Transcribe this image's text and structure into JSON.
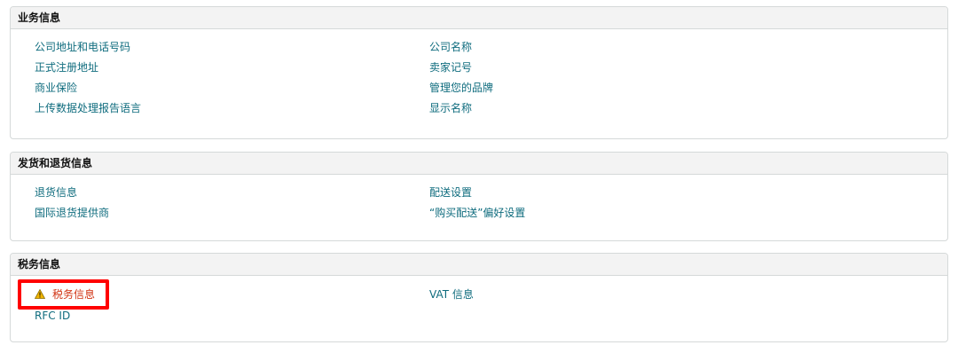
{
  "sections": [
    {
      "title": "业务信息",
      "links": [
        {
          "label": "公司地址和电话号码"
        },
        {
          "label": "正式注册地址"
        },
        {
          "label": "商业保险"
        },
        {
          "label": "上传数据处理报告语言"
        },
        {
          "label": "公司名称"
        },
        {
          "label": "卖家记号"
        },
        {
          "label": "管理您的品牌"
        },
        {
          "label": "显示名称"
        }
      ]
    },
    {
      "title": "发货和退货信息",
      "links": [
        {
          "label": "退货信息"
        },
        {
          "label": "国际退货提供商"
        },
        {
          "label": "配送设置"
        },
        {
          "label": "“购买配送”偏好设置"
        }
      ]
    },
    {
      "title": "税务信息",
      "links": [
        {
          "label": "税务信息",
          "icon": "warning-icon",
          "status": "warning"
        },
        {
          "label": "RFC ID"
        },
        {
          "label": "VAT 信息"
        }
      ]
    }
  ],
  "colors": {
    "link": "#0f6c7e",
    "warning_text": "#d13212",
    "warning_icon": "#f0b400",
    "highlight": "#ff0000",
    "header_bg": "#f3f3f3",
    "border": "#d5d9d9"
  }
}
